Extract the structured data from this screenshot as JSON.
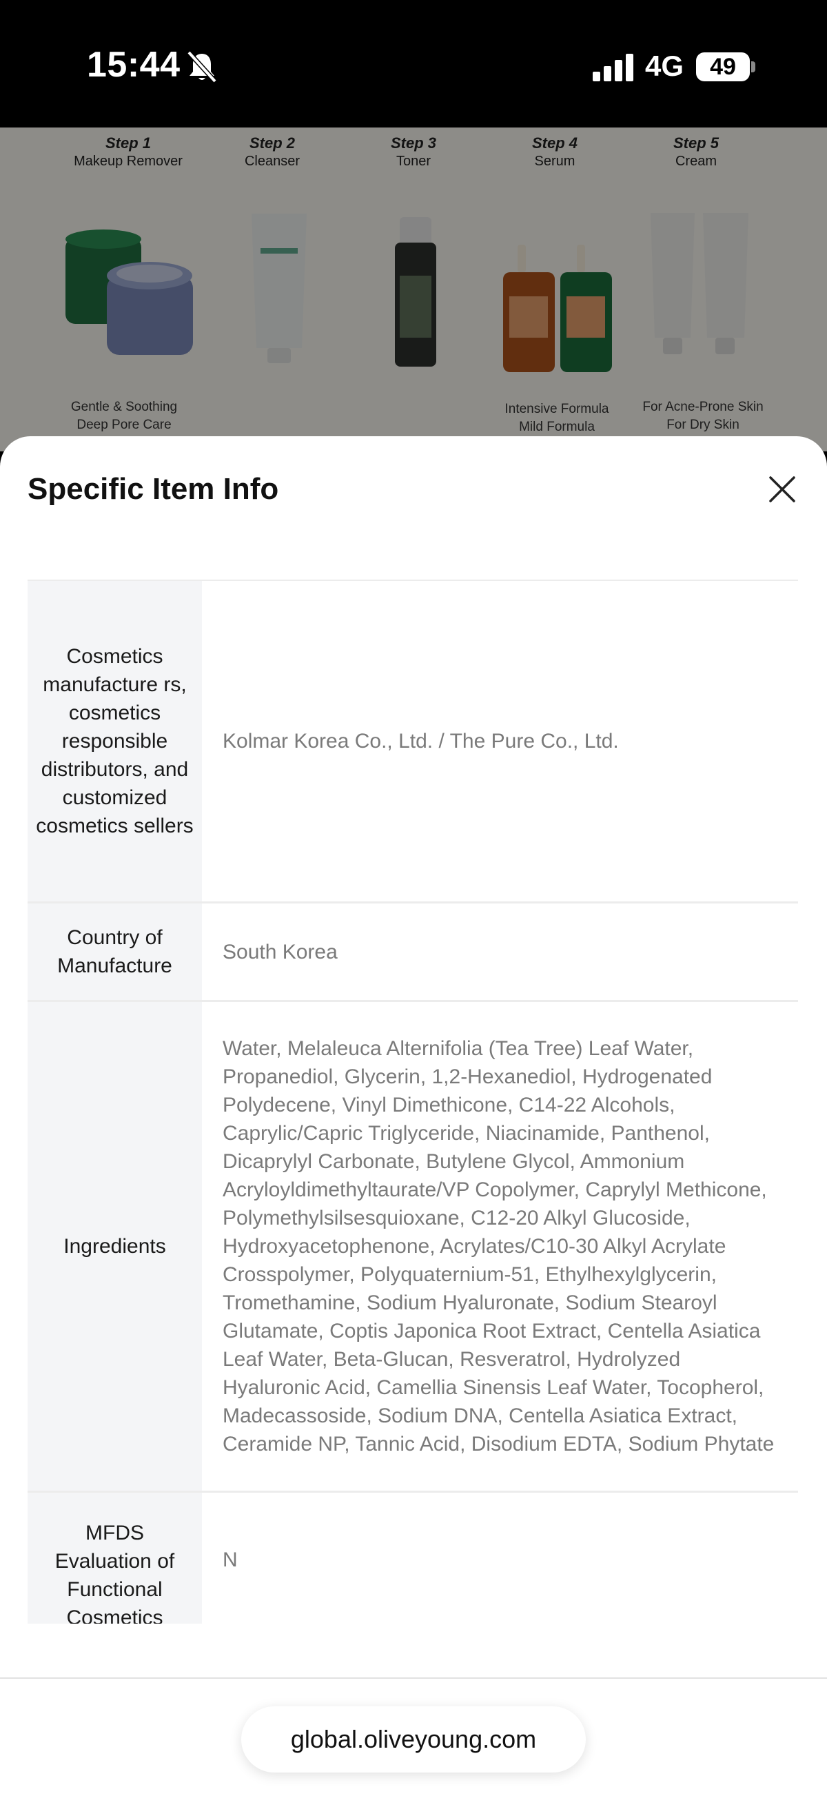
{
  "status_bar": {
    "time": "15:44",
    "network": "4G",
    "battery": "49",
    "bell_icon": "bell-muted-icon"
  },
  "background": {
    "steps": [
      {
        "num": "Step 1",
        "name": "Makeup Remover"
      },
      {
        "num": "Step 2",
        "name": "Cleanser"
      },
      {
        "num": "Step 3",
        "name": "Toner"
      },
      {
        "num": "Step 4",
        "name": "Serum"
      },
      {
        "num": "Step 5",
        "name": "Cream"
      }
    ],
    "captions": [
      {
        "line1": "Gentle & Soothing",
        "line2": "Deep Pore Care"
      },
      {
        "line1": "Intensive Formula",
        "line2": "Mild Formula"
      },
      {
        "line1": "For Acne-Prone Skin",
        "line2": "For Dry Skin"
      }
    ]
  },
  "sheet": {
    "title": "Specific Item Info",
    "close_icon": "close-icon",
    "rows": [
      {
        "label": "Cosmetics manufacture rs, cosmetics responsible distributors, and customized cosmetics sellers",
        "value": "Kolmar Korea Co., Ltd. / The Pure Co., Ltd."
      },
      {
        "label": "Country of Manufacture",
        "value": "South Korea"
      },
      {
        "label": "Ingredients",
        "value": "Water, Melaleuca Alternifolia (Tea Tree) Leaf Water, Propanediol, Glycerin, 1,2-Hexanediol, Hydrogenated Polydecene, Vinyl Dimethicone, C14-22 Alcohols, Caprylic/Capric Triglyceride, Niacinamide, Panthenol, Dicaprylyl Carbonate, Butylene Glycol, Ammonium Acryloyldimethyltaurate/VP Copolymer, Caprylyl Methicone, Polymethylsilsesquioxane, C12-20 Alkyl Glucoside, Hydroxyacetophenone, Acrylates/C10-30 Alkyl Acrylate Crosspolymer, Polyquaternium-51, Ethylhexylglycerin, Tromethamine, Sodium Hyaluronate, Sodium Stearoyl Glutamate, Coptis Japonica Root Extract, Centella Asiatica Leaf Water, Beta-Glucan, Resveratrol, Hydrolyzed Hyaluronic Acid, Camellia Sinensis Leaf Water, Tocopherol, Madecassoside, Sodium DNA, Centella Asiatica Extract, Ceramide NP, Tannic Acid, Disodium EDTA, Sodium Phytate"
      },
      {
        "label": "MFDS Evaluation of Functional Cosmetics",
        "value": "N"
      }
    ]
  },
  "bottom_bar": {
    "url": "global.oliveyoung.com"
  }
}
